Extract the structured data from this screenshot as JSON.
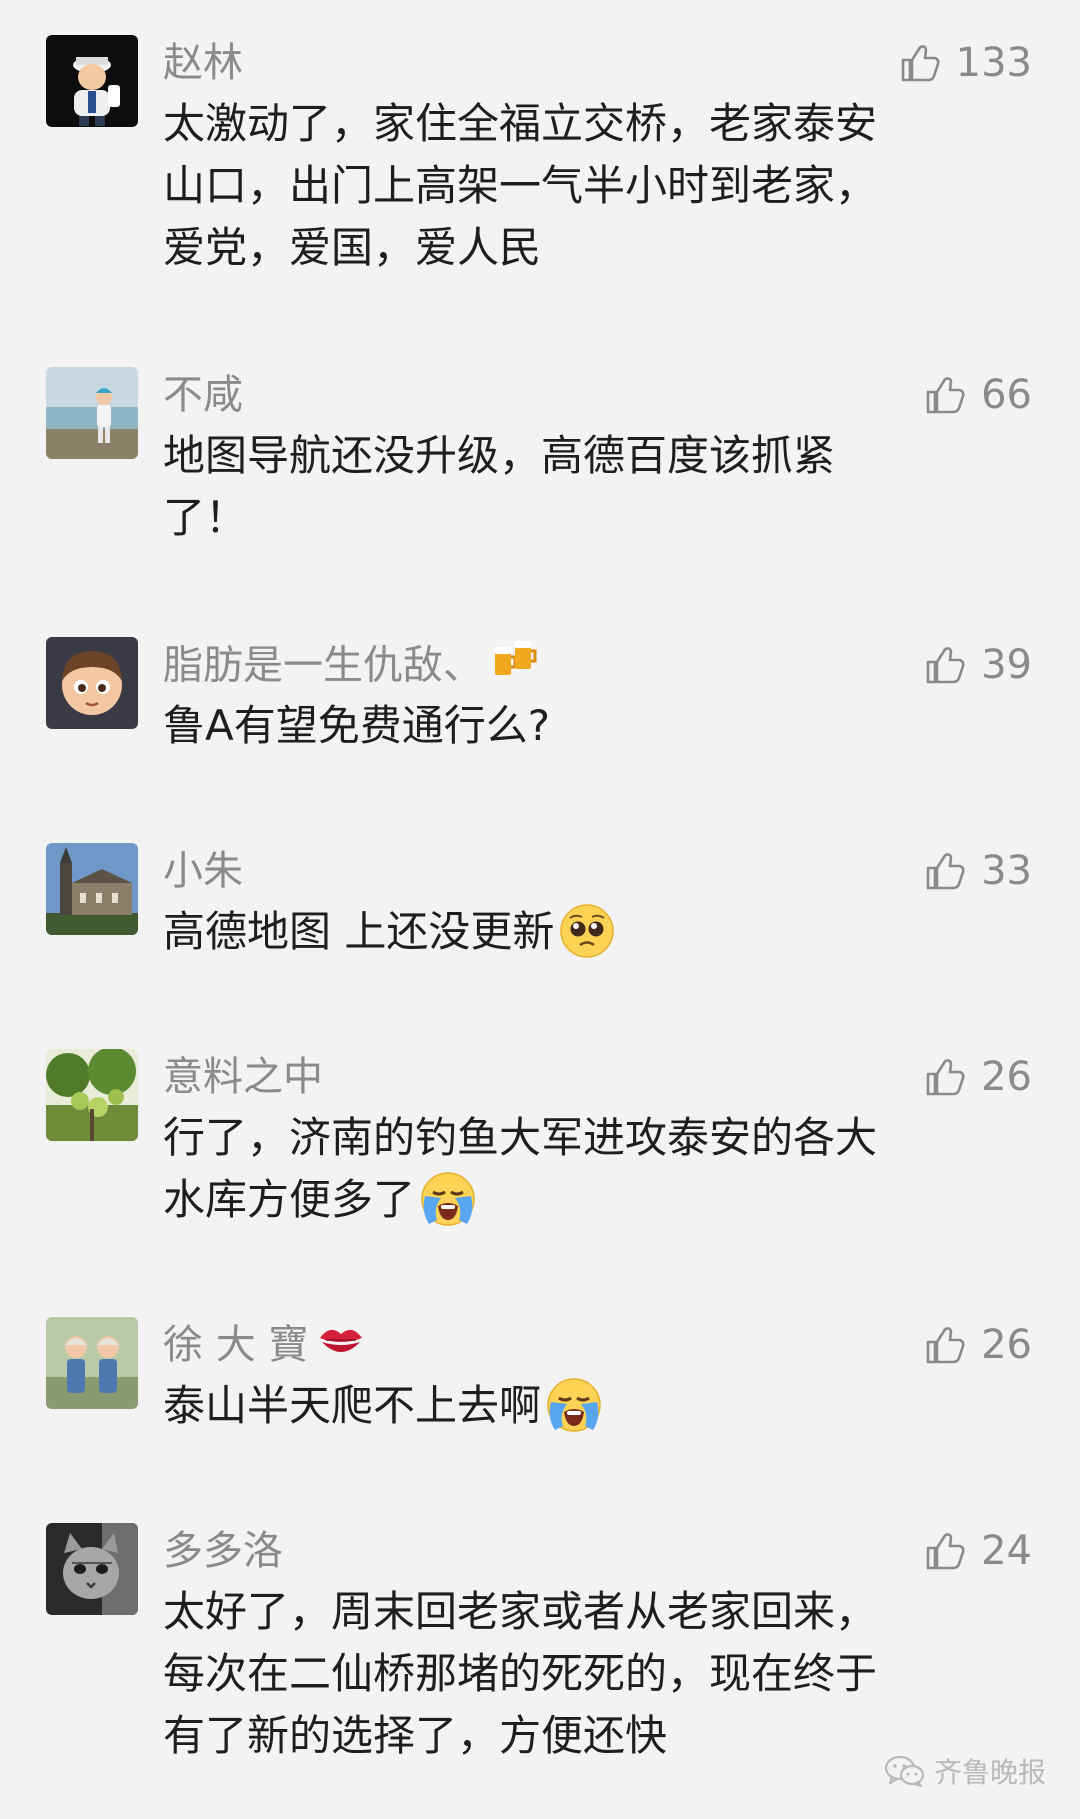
{
  "comments": [
    {
      "username": "赵林",
      "likes": "133",
      "lines": [
        "太激动了，家住全福立交桥，老家泰安",
        "山口，出门上高架一气半小时到老家，",
        "爱党，爱国，爱人民"
      ],
      "avatar_icon": "cartoon-sailor-avatar"
    },
    {
      "username": "不咸",
      "likes": "66",
      "lines": [
        "地图导航还没升级，高德百度该抓紧",
        "了！"
      ],
      "avatar_icon": "child-by-lake-avatar"
    },
    {
      "username": "脂肪是一生仇敌、",
      "name_emoji": "beer-mugs-emoji",
      "likes": "39",
      "lines": [
        "鲁A有望免费通行么?"
      ],
      "avatar_icon": "cartoon-boy-avatar"
    },
    {
      "username": "小朱",
      "likes": "33",
      "lines": [
        "高德地图  上还没更新"
      ],
      "line_emoji": "pleading-face-emoji",
      "avatar_icon": "church-building-avatar"
    },
    {
      "username": "意料之中",
      "likes": "26",
      "lines": [
        "行了，济南的钓鱼大军进攻泰安的各大",
        "水库方便多了"
      ],
      "line_emoji": "loudly-crying-face-emoji",
      "avatar_icon": "green-fruit-tree-avatar"
    },
    {
      "username": "徐 大 寶",
      "name_emoji": "kiss-mark-emoji",
      "likes": "26",
      "lines": [
        "泰山半天爬不上去啊"
      ],
      "line_emoji": "loudly-crying-face-emoji",
      "avatar_icon": "two-children-avatar"
    },
    {
      "username": "多多洛",
      "likes": "24",
      "lines": [
        "太好了，周末回老家或者从老家回来，",
        "每次在二仙桥那堵的死死的，现在终于",
        "有了新的选择了，方便还快"
      ],
      "avatar_icon": "bw-cat-avatar"
    }
  ],
  "watermark": {
    "text": "齐鲁晚报",
    "icon": "wechat-icon"
  },
  "colors": {
    "background": "#f3f3f3",
    "username": "#8a8a8a",
    "content": "#1e1e1e",
    "like_icon": "#8a8a8a",
    "watermark": "#b9b9b9"
  }
}
